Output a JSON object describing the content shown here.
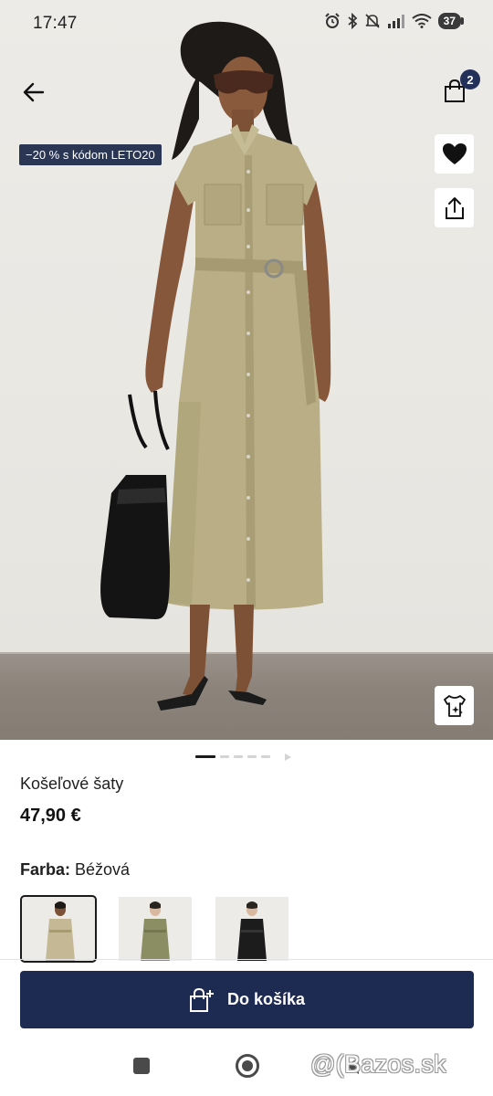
{
  "status_bar": {
    "time": "17:47",
    "battery": "37",
    "icons": [
      "alarm-icon",
      "bluetooth-icon",
      "mute-icon",
      "signal-icon",
      "wifi-icon",
      "battery-icon"
    ]
  },
  "header": {
    "back_icon": "arrow-left-icon",
    "bag_icon": "shopping-bag-icon",
    "bag_count": "2"
  },
  "hero": {
    "promo": "−20 % s kódom LETO20",
    "favorite_icon": "heart-icon",
    "share_icon": "share-icon",
    "tryon_icon": "virtual-tryon-icon",
    "pager": {
      "count": 6,
      "active_index": 0
    },
    "colors": {
      "backdrop": "#ECEBE7",
      "floor": "#8C847B",
      "dress": "#B9AE86"
    }
  },
  "product": {
    "name": "Košeľové šaty",
    "price": "47,90 €",
    "color_label": "Farba:",
    "color_value": "Béžová",
    "swatches": [
      {
        "name": "Béžová",
        "color": "#C4B994",
        "selected": true
      },
      {
        "name": "Olivová",
        "color": "#8A8E62",
        "selected": false
      },
      {
        "name": "Čierna",
        "color": "#1C1C1C",
        "selected": false
      }
    ]
  },
  "cta": {
    "label": "Do košíka",
    "icon": "add-to-bag-icon",
    "color": "#1D2A52"
  },
  "nav_bar": {
    "watermark": "@(Bazos.sk"
  }
}
